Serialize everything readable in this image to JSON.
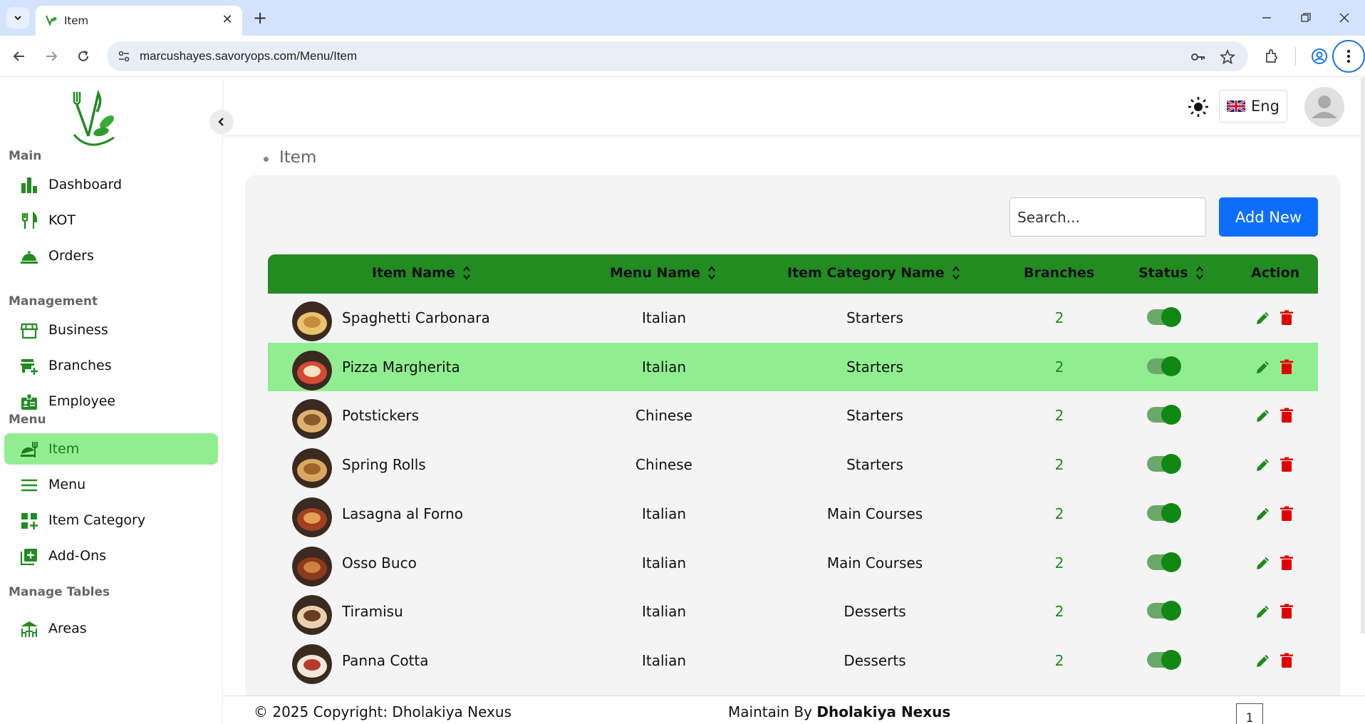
{
  "browser": {
    "tab_title": "Item",
    "url": "marcushayes.savoryops.com/Menu/Item"
  },
  "sidebar": {
    "sections": [
      {
        "title": "Main",
        "items": [
          {
            "label": "Dashboard",
            "icon": "bar-chart-icon"
          },
          {
            "label": "KOT",
            "icon": "fork-knife-icon"
          },
          {
            "label": "Orders",
            "icon": "cloche-icon"
          }
        ]
      },
      {
        "title": "Management",
        "items": [
          {
            "label": "Business",
            "icon": "store-icon"
          },
          {
            "label": "Branches",
            "icon": "add-business-icon"
          },
          {
            "label": "Employee",
            "icon": "badge-icon"
          }
        ]
      },
      {
        "title": "Menu",
        "items": [
          {
            "label": "Item",
            "icon": "dining-icon",
            "active": true
          },
          {
            "label": "Menu",
            "icon": "menu-lines-icon"
          },
          {
            "label": "Item Category",
            "icon": "grid-add-icon"
          },
          {
            "label": "Add-Ons",
            "icon": "library-add-icon"
          }
        ]
      },
      {
        "title": "Manage Tables",
        "items": [
          {
            "label": "Areas",
            "icon": "deck-icon"
          }
        ]
      }
    ]
  },
  "header": {
    "language": "Eng"
  },
  "breadcrumb": "Item",
  "search": {
    "placeholder": "Search..."
  },
  "add_new_label": "Add New",
  "table": {
    "columns": [
      "Item Name",
      "Menu Name",
      "Item Category Name",
      "Branches",
      "Status",
      "Action"
    ],
    "rows": [
      {
        "name": "Spaghetti Carbonara",
        "menu": "Italian",
        "category": "Starters",
        "branches": "2",
        "status": true
      },
      {
        "name": "Pizza Margherita",
        "menu": "Italian",
        "category": "Starters",
        "branches": "2",
        "status": true
      },
      {
        "name": "Potstickers",
        "menu": "Chinese",
        "category": "Starters",
        "branches": "2",
        "status": true
      },
      {
        "name": "Spring Rolls",
        "menu": "Chinese",
        "category": "Starters",
        "branches": "2",
        "status": true
      },
      {
        "name": "Lasagna al Forno",
        "menu": "Italian",
        "category": "Main Courses",
        "branches": "2",
        "status": true
      },
      {
        "name": "Osso Buco",
        "menu": "Italian",
        "category": "Main Courses",
        "branches": "2",
        "status": true
      },
      {
        "name": "Tiramisu",
        "menu": "Italian",
        "category": "Desserts",
        "branches": "2",
        "status": true
      },
      {
        "name": "Panna Cotta",
        "menu": "Italian",
        "category": "Desserts",
        "branches": "2",
        "status": true
      }
    ]
  },
  "footer": {
    "copyright": "© 2025 Copyright: Dholakiya Nexus",
    "maintain_prefix": "Maintain By ",
    "maintain_name": "Dholakiya Nexus",
    "page": "1"
  },
  "colors": {
    "primary_green": "#228b22",
    "highlight": "#90ee90",
    "button_blue": "#0d6efd",
    "delete_red": "#e00000"
  }
}
